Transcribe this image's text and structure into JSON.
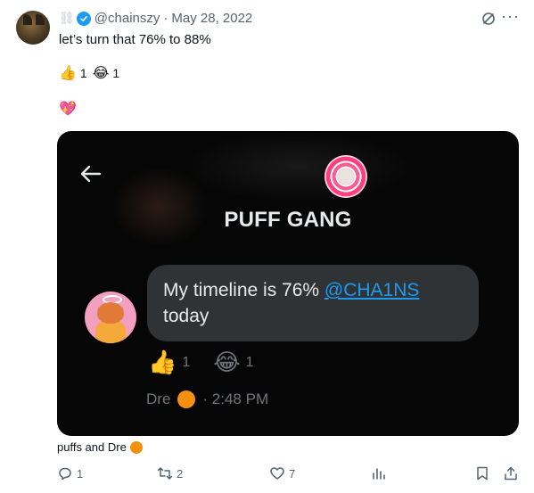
{
  "tweet": {
    "handle": "@chainszy",
    "separator": "·",
    "date": "May 28, 2022",
    "text": "let’s turn that 76% to 88%",
    "reactions": [
      {
        "emoji": "👍",
        "count": "1"
      },
      {
        "emoji": "😂",
        "count": "1"
      }
    ],
    "heart": "💖",
    "more_label": "···",
    "reacted_by": "puffs and Dre"
  },
  "embed": {
    "group_name": "PUFF GANG",
    "message_text": "My timeline is 76% ",
    "message_mention": "@CHA1NS",
    "message_text_end": "today",
    "reactions": [
      {
        "emoji": "👍",
        "count": "1"
      },
      {
        "emoji": "😂",
        "count": "1"
      }
    ],
    "sender": "Dre",
    "time": "· 2:48 PM"
  },
  "actions": {
    "reply_count": "1",
    "retweet_count": "2",
    "like_count": "7"
  },
  "colors": {
    "verified": "#1d9bf0",
    "link": "#1d9bf0",
    "muted": "#536471",
    "bubble": "#2f3336"
  }
}
